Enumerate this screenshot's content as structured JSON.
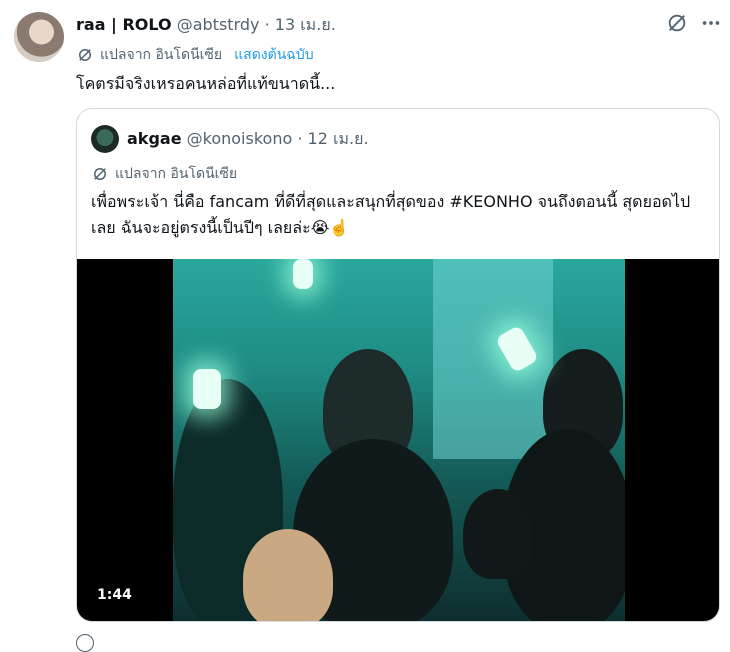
{
  "tweet": {
    "display_name": "raa | ROLO",
    "handle": "@abtstrdy",
    "date": "13 เม.ย.",
    "translated_from": "แปลจาก อินโดนีเซีย",
    "show_original": "แสดงต้นฉบับ",
    "text": "โคตรมีจริงเหรอคนหล่อที่แท้ขนาดนี้..."
  },
  "quote": {
    "display_name": "akgae",
    "handle": "@konoiskono",
    "date": "12 เม.ย.",
    "translated_from": "แปลจาก อินโดนีเซีย",
    "text": "เพื่อพระเจ้า นี่คือ fancam ที่ดีที่สุดและสนุกที่สุดของ #KEONHO จนถึงตอนนี้ สุดยอดไปเลย ฉันจะอยู่ตรงนี้เป็นปีๆ เลยล่ะ😭☝️",
    "video_duration": "1:44"
  },
  "icons": [
    "grok-icon",
    "more-icon",
    "translate-icon",
    "play-video"
  ]
}
